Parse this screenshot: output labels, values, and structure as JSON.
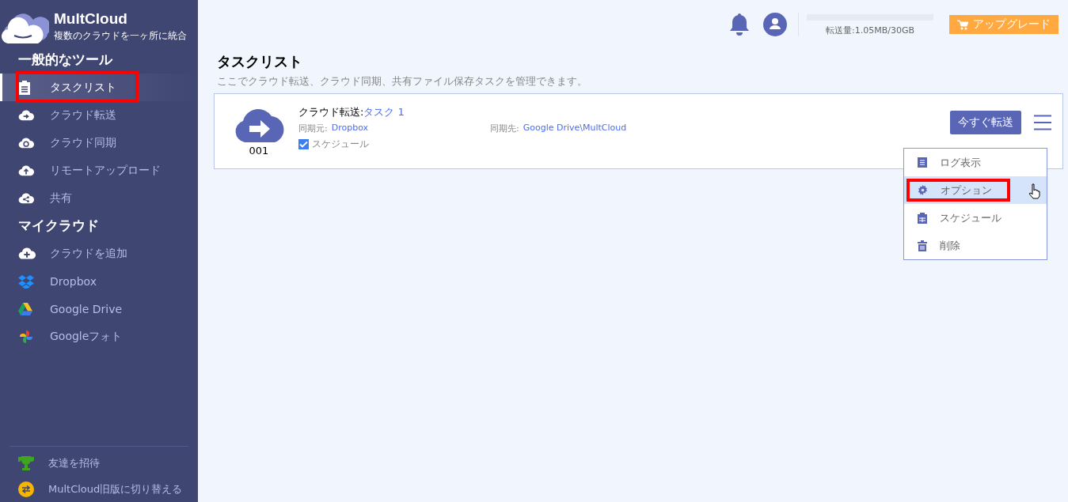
{
  "brand": {
    "name": "MultCloud",
    "tagline": "複数のクラウドを一ヶ所に統合"
  },
  "sidebar": {
    "sections": [
      {
        "title": "一般的なツール",
        "items": [
          {
            "label": "タスクリスト",
            "selected": true,
            "highlighted": true
          },
          {
            "label": "クラウド転送",
            "selected": false,
            "highlighted": false
          },
          {
            "label": "クラウド同期",
            "selected": false,
            "highlighted": false
          },
          {
            "label": "リモートアップロード",
            "selected": false,
            "highlighted": false
          },
          {
            "label": "共有",
            "selected": false,
            "highlighted": false
          }
        ]
      },
      {
        "title": "マイクラウド",
        "items": [
          {
            "label": "クラウドを追加",
            "selected": false,
            "highlighted": false
          },
          {
            "label": "Dropbox",
            "selected": false,
            "highlighted": false
          },
          {
            "label": "Google Drive",
            "selected": false,
            "highlighted": false
          },
          {
            "label": "Googleフォト",
            "selected": false,
            "highlighted": false
          }
        ]
      }
    ],
    "footer": [
      {
        "label": "友達を招待"
      },
      {
        "label": "MultCloud旧版に切り替える"
      }
    ]
  },
  "header": {
    "usage": {
      "reading": "転送量:1.05MB/30GB"
    },
    "upgrade": "アップグレード"
  },
  "page": {
    "title": "タスクリスト",
    "description": "ここでクラウド転送、クラウド同期、共有ファイル保存タスクを管理できます。"
  },
  "tasks": [
    {
      "number": "001",
      "type": "クラウド転送:",
      "name": "タスク 1",
      "source_label": "同期元:",
      "source": "Dropbox",
      "target_label": "同期先:",
      "target": "Google Drive\\MultCloud",
      "schedule": {
        "label": "スケジュール",
        "checked": true
      },
      "action": "今すぐ転送",
      "menu": [
        {
          "label": "ログ表示",
          "selected": false,
          "highlighted": false
        },
        {
          "label": "オプション",
          "selected": true,
          "highlighted": true
        },
        {
          "label": "スケジュール",
          "selected": false,
          "highlighted": false
        },
        {
          "label": "削除",
          "selected": false,
          "highlighted": false
        }
      ]
    }
  ]
}
